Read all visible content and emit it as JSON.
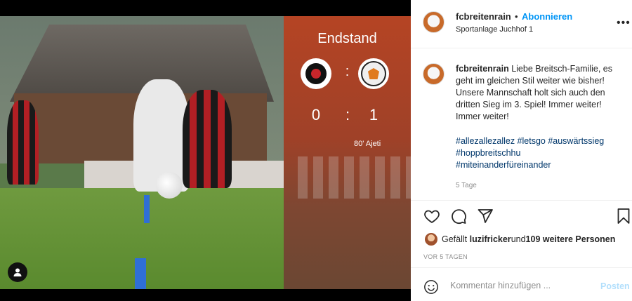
{
  "post": {
    "scoreboard": {
      "title": "Endstand",
      "colon": ":",
      "home_score": "0",
      "separator": ":",
      "away_score": "1",
      "scorer": "80' Ajeti"
    }
  },
  "panel": {
    "header": {
      "username": "fcbreitenrain",
      "dot": "•",
      "follow_label": "Abonnieren",
      "location": "Sportanlage Juchhof 1",
      "more": "•••"
    },
    "caption": {
      "username": "fcbreitenrain",
      "text": "Liebe Breitsch-Familie, es geht im gleichen Stil weiter wie bisher! Unsere Mannschaft holt sich auch den dritten Sieg im 3. Spiel! Immer weiter! Immer weiter!",
      "hashtags": [
        "#allezallezallez #letsgo #auswärtssieg",
        "#hoppbreitschhu",
        "#miteinanderfüreinander"
      ],
      "age": "5 Tage"
    },
    "actions": {
      "like_icon": "heart-icon",
      "comment_icon": "comment-icon",
      "share_icon": "paper-plane-icon",
      "save_icon": "bookmark-icon"
    },
    "likes": {
      "prefix": "Gefällt ",
      "user": "luzifricker",
      "middle": " und ",
      "count": "109 weitere Personen"
    },
    "timestamp": "VOR 5 TAGEN",
    "comment": {
      "placeholder": "Kommentar hinzufügen ...",
      "post_label": "Posten"
    }
  },
  "colors": {
    "accent": "#0095f6",
    "text": "#262626",
    "muted": "#8e8e8e",
    "hashtag": "#00376b"
  }
}
